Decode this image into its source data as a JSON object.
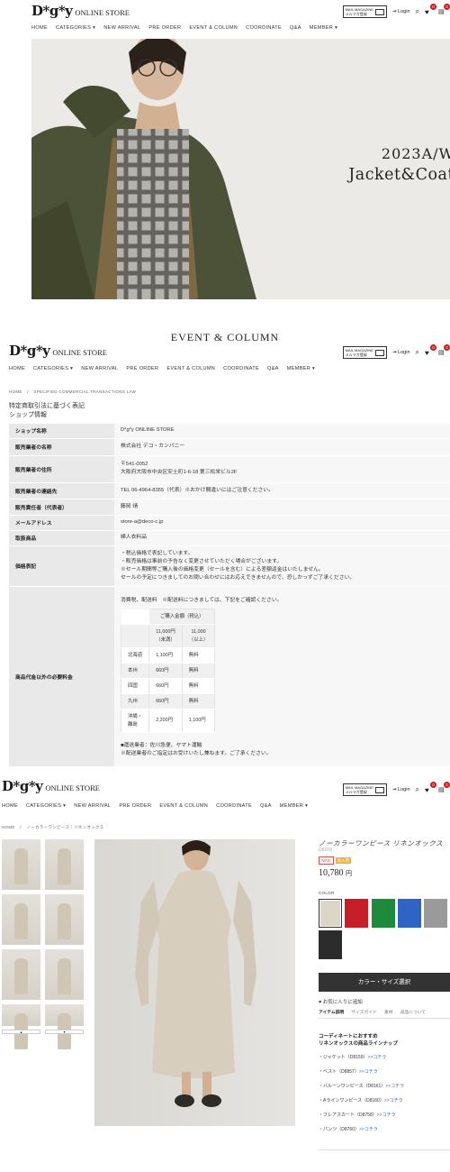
{
  "brand": {
    "mark": "D*g*y",
    "store": "ONLINE STORE"
  },
  "header": {
    "mail_line1": "MAIL MAGAZINE",
    "mail_line2": "メルマガ登録",
    "login": "Login",
    "fav_count": "0",
    "cart_count": "0"
  },
  "nav": [
    "HOME",
    "CATEGORIES ▾",
    "NEW ARRIVAL",
    "PRE ORDER",
    "EVENT & COLUMN",
    "COORDINATE",
    "Q&A",
    "MEMBER ▾"
  ],
  "hero": {
    "line1": "2023A/W",
    "line2": "Jacket&Coat"
  },
  "section_title": "EVENT & COLUMN",
  "law": {
    "breadcrumb_home": "HOME",
    "breadcrumb_sep": "/",
    "breadcrumb_page": "SPECIFIED COMMERCIAL TRANSACTIONS LAW",
    "title1": "特定商取引法に基づく表記",
    "title2": "ショップ情報",
    "rows": [
      {
        "k": "ショップ名称",
        "v": [
          "D*g*y ONLINE STORE"
        ]
      },
      {
        "k": "販売業者の名称",
        "v": [
          "株式会社 デコ・カンパニー"
        ]
      },
      {
        "k": "販売業者の住所",
        "v": [
          "〒541-0052",
          "大阪府大阪市中央区安土町1-6-18 第三松栄ビル2F"
        ]
      },
      {
        "k": "販売業者の連絡先",
        "v": [
          "TEL 06-4964-8355（代表）※おかけ間違いにはご注意ください。"
        ]
      },
      {
        "k": "販売責任者（代表者）",
        "v": [
          "藤岡 靖"
        ]
      },
      {
        "k": "メールアドレス",
        "v": [
          "store-a@deco-c.jp"
        ]
      },
      {
        "k": "取扱商品",
        "v": [
          "婦人衣料品"
        ]
      },
      {
        "k": "価格表記",
        "v": [
          "・税込価格で表記しています。",
          "・販売価格は事前の予告なく変更させていただく場合がございます。",
          "※セール期間等ご購入後の価格変更（セールを含む）による差額返金はいたしません。",
          "セールの予定につきましてのお問い合わせにはお応えできませんので、恐しかっずご了承ください。"
        ]
      }
    ],
    "fee_key": "商品代金以外の必要料金",
    "fee_intro": "消費税、配送料　※配送料につきましては、下記をご確認ください。",
    "fee_table": {
      "head": "ご購入金額（税込）",
      "col1": "11,000円（未満）",
      "col1_a": "11,000円",
      "col1_b": "（未満）",
      "col2_a": "11,000",
      "col2_b": "（以上）",
      "rows": [
        {
          "region": "北海道",
          "a": "1,100円",
          "b": "無料"
        },
        {
          "region": "本州",
          "a": "660円",
          "b": "無料"
        },
        {
          "region": "四国",
          "a": "660円",
          "b": "無料"
        },
        {
          "region": "九州",
          "a": "660円",
          "b": "無料"
        },
        {
          "region_a": "沖縄・",
          "region_b": "離島",
          "a": "2,200円",
          "b": "1,100円"
        }
      ]
    },
    "fee_note1": "■運送業者：佐川急便、ヤマト運輸",
    "fee_note2": "※配送業者のご指定はお受けいたし兼ねます。ご了承ください。"
  },
  "product": {
    "breadcrumb_home": "HOME",
    "breadcrumb_sep": "/",
    "breadcrumb_page": "ノーカラーワンピース｜リネンオックス",
    "name": "ノーカラーワンピース リネンオックス",
    "code": "D8169",
    "tag_new": "NEW",
    "tag_restock": "再入荷",
    "price": "10,780",
    "price_unit": "円",
    "color_label": "COLOR",
    "colors": [
      "#dcd6c9",
      "#c61f2a",
      "#1d8a3c",
      "#2f63c4",
      "#9a9a9a",
      "#2c2c2c"
    ],
    "select_btn": "カラー・サイズ選択",
    "fav": "お気に入りに追加",
    "tabs": [
      "アイテム説明",
      "サイズガイド",
      "素材",
      "返品について"
    ],
    "coord_title1": "コーディネートにおすすめ",
    "coord_title2": "リネンオックスの商品ラインナップ",
    "coord_items": [
      {
        "label": "・ジャケット（D8159）",
        "link": ">>コチラ"
      },
      {
        "label": "・ベスト（D8857）",
        "link": ">>コチラ"
      },
      {
        "label": "・バルーンワンピース（D8161）",
        "link": ">>コチラ"
      },
      {
        "label": "・Aラインワンピース（D8160）",
        "link": ">>コチラ"
      },
      {
        "label": "・フレアスカート（D8758）",
        "link": ">>コチラ"
      },
      {
        "label": "・パンツ（D8760）",
        "link": ">>コチラ"
      }
    ]
  }
}
